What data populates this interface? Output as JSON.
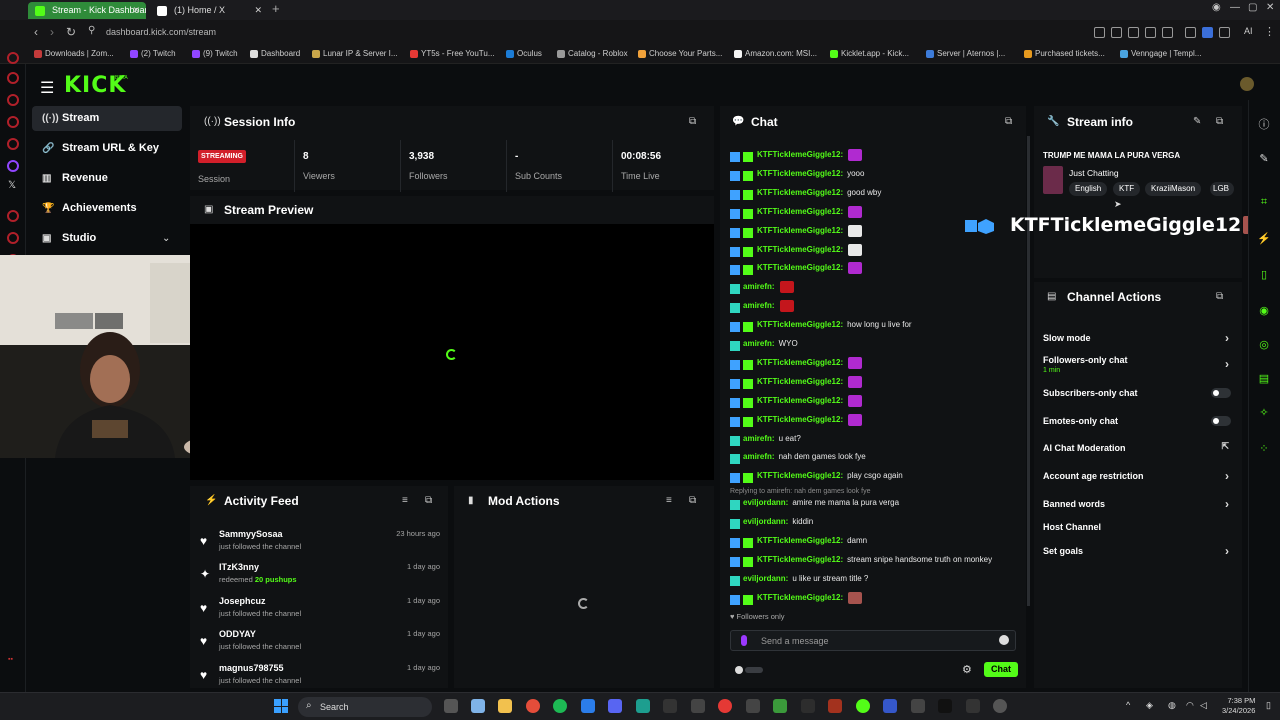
{
  "browser": {
    "tabs": [
      {
        "label": "Stream - Kick Dashboard"
      },
      {
        "label": "(1) Home / X"
      }
    ],
    "url": "dashboard.kick.com/stream",
    "ai_label": "AI",
    "bookmarks": [
      {
        "label": "Downloads | Zom...",
        "color": "#c43b3b"
      },
      {
        "label": "(2) Twitch",
        "color": "#9146ff"
      },
      {
        "label": "(9) Twitch",
        "color": "#9146ff"
      },
      {
        "label": "Dashboard",
        "color": "#dddddd"
      },
      {
        "label": "Lunar IP & Server I...",
        "color": "#c9a64a"
      },
      {
        "label": "YT5s - Free YouTu...",
        "color": "#e53935"
      },
      {
        "label": "Oculus",
        "color": "#1c7cd6"
      },
      {
        "label": "Catalog - Roblox",
        "color": "#9a9a9a"
      },
      {
        "label": "Choose Your Parts...",
        "color": "#f0a13a"
      },
      {
        "label": "Amazon.com: MSI...",
        "color": "#f5f5f5"
      },
      {
        "label": "Kicklet.app - Kick...",
        "color": "#53fc18"
      },
      {
        "label": "Server | Aternos |...",
        "color": "#3d7bd9"
      },
      {
        "label": "Purchased tickets...",
        "color": "#e79a1f"
      },
      {
        "label": "Venngage | Templ...",
        "color": "#4aa3df"
      }
    ]
  },
  "nav": {
    "logo": "KICK",
    "logo_beta": "BETA",
    "items": [
      {
        "label": "Stream"
      },
      {
        "label": "Stream URL & Key"
      },
      {
        "label": "Revenue"
      },
      {
        "label": "Achievements"
      },
      {
        "label": "Studio"
      }
    ]
  },
  "session_info": {
    "title": "Session Info",
    "status_badge": "STREAMING",
    "status_label": "Session",
    "stats": [
      {
        "value": "8",
        "label": "Viewers"
      },
      {
        "value": "3,938",
        "label": "Followers"
      },
      {
        "value": "-",
        "label": "Sub Counts"
      },
      {
        "value": "00:08:56",
        "label": "Time Live"
      }
    ]
  },
  "stream_preview": {
    "title": "Stream Preview"
  },
  "activity_feed": {
    "title": "Activity Feed",
    "items": [
      {
        "name": "SammyySosaa",
        "action": "just followed the channel",
        "time": "23 hours ago",
        "highlight": ""
      },
      {
        "name": "ITzK3nny",
        "action": "redeemed ",
        "highlight": "20 pushups",
        "time": "1 day ago"
      },
      {
        "name": "Josephcuz",
        "action": "just followed the channel",
        "time": "1 day ago",
        "highlight": ""
      },
      {
        "name": "ODDYAY",
        "action": "just followed the channel",
        "time": "1 day ago",
        "highlight": ""
      },
      {
        "name": "magnus798755",
        "action": "just followed the channel",
        "time": "1 day ago",
        "highlight": ""
      }
    ]
  },
  "mod_actions": {
    "title": "Mod Actions"
  },
  "chat": {
    "title": "Chat",
    "messages": [
      {
        "user": "KTFTicklemeGiggle12:",
        "text": "",
        "color": "#53fc18",
        "emote": "#b02ad0",
        "badges": "sub"
      },
      {
        "user": "KTFTicklemeGiggle12:",
        "text": "yooo",
        "color": "#53fc18",
        "emote": "",
        "badges": "sub"
      },
      {
        "user": "KTFTicklemeGiggle12:",
        "text": "good wby",
        "color": "#53fc18",
        "emote": "",
        "badges": "sub"
      },
      {
        "user": "KTFTicklemeGiggle12:",
        "text": "",
        "color": "#53fc18",
        "emote": "#b02ad0",
        "badges": "sub"
      },
      {
        "user": "KTFTicklemeGiggle12:",
        "text": "",
        "color": "#53fc18",
        "emote": "#e8e8e8",
        "badges": "sub"
      },
      {
        "user": "KTFTicklemeGiggle12:",
        "text": "",
        "color": "#53fc18",
        "emote": "#e8e8e8",
        "badges": "sub"
      },
      {
        "user": "KTFTicklemeGiggle12:",
        "text": "",
        "color": "#53fc18",
        "emote": "#b02ad0",
        "badges": "sub"
      },
      {
        "user": "amirefn:",
        "text": "",
        "color": "#53fc18",
        "emote": "#c4161c",
        "badges": "mod"
      },
      {
        "user": "amirefn:",
        "text": "",
        "color": "#53fc18",
        "emote": "#c4161c",
        "badges": "mod"
      },
      {
        "user": "KTFTicklemeGiggle12:",
        "text": "how long u live for",
        "color": "#53fc18",
        "emote": "",
        "badges": "sub"
      },
      {
        "user": "amirefn:",
        "text": "WYO",
        "color": "#53fc18",
        "emote": "",
        "badges": "mod"
      },
      {
        "user": "KTFTicklemeGiggle12:",
        "text": "",
        "color": "#53fc18",
        "emote": "#b02ad0",
        "badges": "sub"
      },
      {
        "user": "KTFTicklemeGiggle12:",
        "text": "",
        "color": "#53fc18",
        "emote": "#b02ad0",
        "badges": "sub"
      },
      {
        "user": "KTFTicklemeGiggle12:",
        "text": "",
        "color": "#53fc18",
        "emote": "#b02ad0",
        "badges": "sub"
      },
      {
        "user": "KTFTicklemeGiggle12:",
        "text": "",
        "color": "#53fc18",
        "emote": "#b02ad0",
        "badges": "sub"
      },
      {
        "user": "amirefn:",
        "text": "u eat?",
        "color": "#53fc18",
        "emote": "",
        "badges": "mod"
      },
      {
        "user": "amirefn:",
        "text": "nah dem games look fye",
        "color": "#53fc18",
        "emote": "",
        "badges": "mod"
      },
      {
        "user": "KTFTicklemeGiggle12:",
        "text": "play csgo again",
        "color": "#53fc18",
        "emote": "",
        "badges": "sub"
      }
    ],
    "reply_note": "Replying to amirefn: nah dem games look fye",
    "messages_after": [
      {
        "user": "eviljordann:",
        "text": "amire me mama la pura verga",
        "color": "#53fc18",
        "emote": "",
        "badges": "mod"
      },
      {
        "user": "eviljordann:",
        "text": "kiddin",
        "color": "#53fc18",
        "emote": "",
        "badges": "mod"
      },
      {
        "user": "KTFTicklemeGiggle12:",
        "text": "damn",
        "color": "#53fc18",
        "emote": "",
        "badges": "sub"
      },
      {
        "user": "KTFTicklemeGiggle12:",
        "text": "stream snipe handsome truth on monkey",
        "color": "#53fc18",
        "emote": "",
        "badges": "sub"
      },
      {
        "user": "eviljordann:",
        "text": "u like ur stream title ?",
        "color": "#53fc18",
        "emote": "",
        "badges": "mod"
      },
      {
        "user": "KTFTicklemeGiggle12:",
        "text": "",
        "color": "#53fc18",
        "emote": "#a6534e",
        "badges": "sub"
      }
    ],
    "followers_only": "Followers only",
    "input_placeholder": "Send a message",
    "send_label": "Chat"
  },
  "stream_info": {
    "title": "Stream info",
    "stream_title": "TRUMP ME MAMA LA PURA VERGA",
    "category": "Just Chatting",
    "tags": [
      "English",
      "KTF",
      "KraziiMason",
      "LGB"
    ]
  },
  "alert": {
    "text": "KTFTicklemeGiggle12 :"
  },
  "channel_actions": {
    "title": "Channel Actions",
    "items": [
      {
        "label": "Slow mode",
        "sub": "",
        "control": "chevron"
      },
      {
        "label": "Followers-only chat",
        "sub": "1 min",
        "control": "chevron"
      },
      {
        "label": "Subscribers-only chat",
        "sub": "",
        "control": "toggle"
      },
      {
        "label": "Emotes-only chat",
        "sub": "",
        "control": "toggle"
      },
      {
        "label": "AI Chat Moderation",
        "sub": "",
        "control": "external"
      },
      {
        "label": "Account age restriction",
        "sub": "",
        "control": "chevron"
      },
      {
        "label": "Banned words",
        "sub": "",
        "control": "chevron"
      },
      {
        "label": "Host Channel",
        "sub": "",
        "control": "none"
      },
      {
        "label": "Set goals",
        "sub": "",
        "control": "chevron"
      }
    ]
  },
  "taskbar": {
    "search": "Search",
    "time": "7:38 PM",
    "date": "3/24/2026"
  },
  "colors": {
    "accent": "#53fc18",
    "live": "#d21f2a",
    "panel": "#101214",
    "background": "#0b0d0f"
  }
}
